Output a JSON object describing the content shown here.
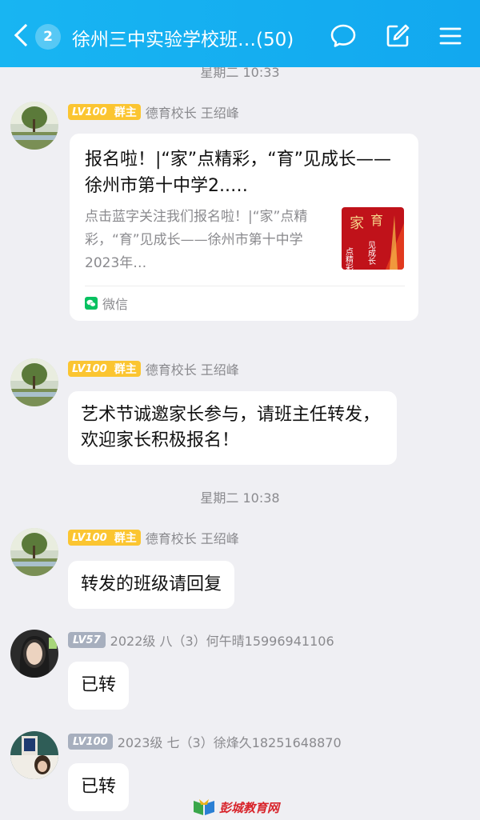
{
  "header": {
    "unread_count": "2",
    "title": "徐州三中实验学校班…(50)",
    "bg_color": "#12a8ef"
  },
  "icons": {
    "back": "chevron-left-icon",
    "chat": "speech-bubble-icon",
    "edit": "edit-icon",
    "menu": "menu-icon",
    "source": "wechat-icon"
  },
  "messages": [
    {
      "time_top": "星期二 10:33",
      "badge_level": "LV100",
      "badge_role": "群主",
      "sender": "德育校长  王绍峰",
      "card": {
        "title": "报名啦！|“家”点精彩，“育”见成长——徐州市第十中学2..…",
        "desc": "点击蓝字关注我们报名啦！|“家”点精彩，“育”见成长——徐州市第十中学2023年…",
        "source": "微信",
        "thumb_text": [
          "家",
          "育",
          "点精彩",
          "见成长"
        ]
      }
    },
    {
      "badge_level": "LV100",
      "badge_role": "群主",
      "sender": "德育校长  王绍峰",
      "text": "艺术节诚邀家长参与，请班主任转发，欢迎家长积极报名！"
    },
    {
      "time": "星期二 10:38",
      "badge_level": "LV100",
      "badge_role": "群主",
      "sender": "德育校长  王绍峰",
      "text": "转发的班级请回复"
    },
    {
      "badge_level": "LV57",
      "sender": "2022级  八（3）何午晴15996941106",
      "text": "已转"
    },
    {
      "badge_level": "LV100",
      "sender": "2023级  七（3）徐烽久18251648870",
      "text": "已转"
    }
  ],
  "watermark": "彭城教育网"
}
